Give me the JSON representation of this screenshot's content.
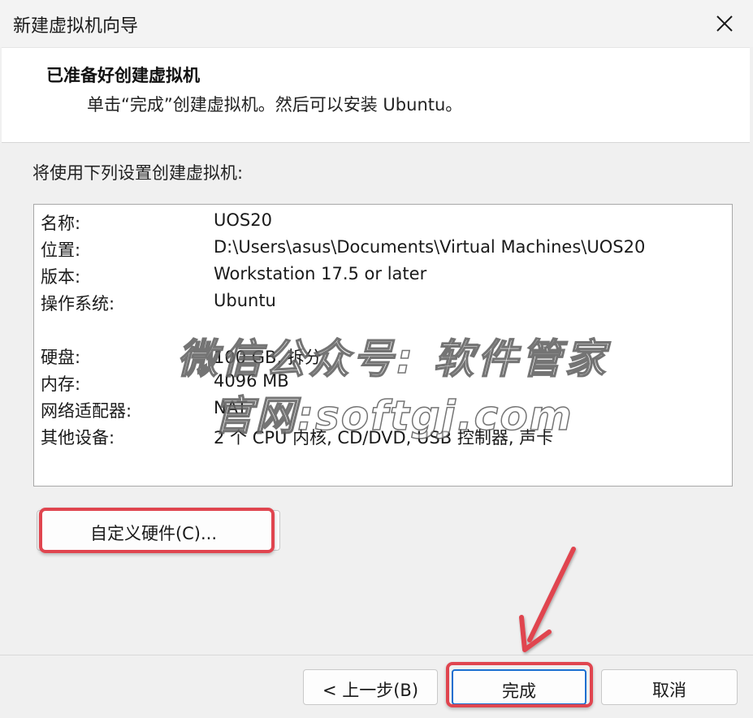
{
  "window": {
    "title": "新建虚拟机向导",
    "close_icon": "close-icon"
  },
  "header": {
    "title": "已准备好创建虚拟机",
    "subtitle": "单击“完成”创建虚拟机。然后可以安装 Ubuntu。"
  },
  "main": {
    "intro": "将使用下列设置创建虚拟机:",
    "settings": [
      {
        "label": "名称:",
        "value": "UOS20"
      },
      {
        "label": "位置:",
        "value": "D:\\Users\\asus\\Documents\\Virtual Machines\\UOS20"
      },
      {
        "label": "版本:",
        "value": "Workstation 17.5 or later"
      },
      {
        "label": "操作系统:",
        "value": "Ubuntu"
      },
      {
        "label": "硬盘:",
        "value": "100 GB, 拆分"
      },
      {
        "label": "内存:",
        "value": "4096 MB"
      },
      {
        "label": "网络适配器:",
        "value": "NAT"
      },
      {
        "label": "其他设备:",
        "value": "2 个 CPU 内核, CD/DVD, USB 控制器, 声卡"
      }
    ],
    "customize_label": "自定义硬件(C)..."
  },
  "watermark": {
    "line1": "微信公众号: 软件管家",
    "line2": "官网:softgj.com"
  },
  "footer": {
    "back_label": "< 上一步(B)",
    "finish_label": "完成",
    "cancel_label": "取消"
  },
  "colors": {
    "highlight": "#e0454f",
    "default_button_border": "#1a6fd0"
  }
}
